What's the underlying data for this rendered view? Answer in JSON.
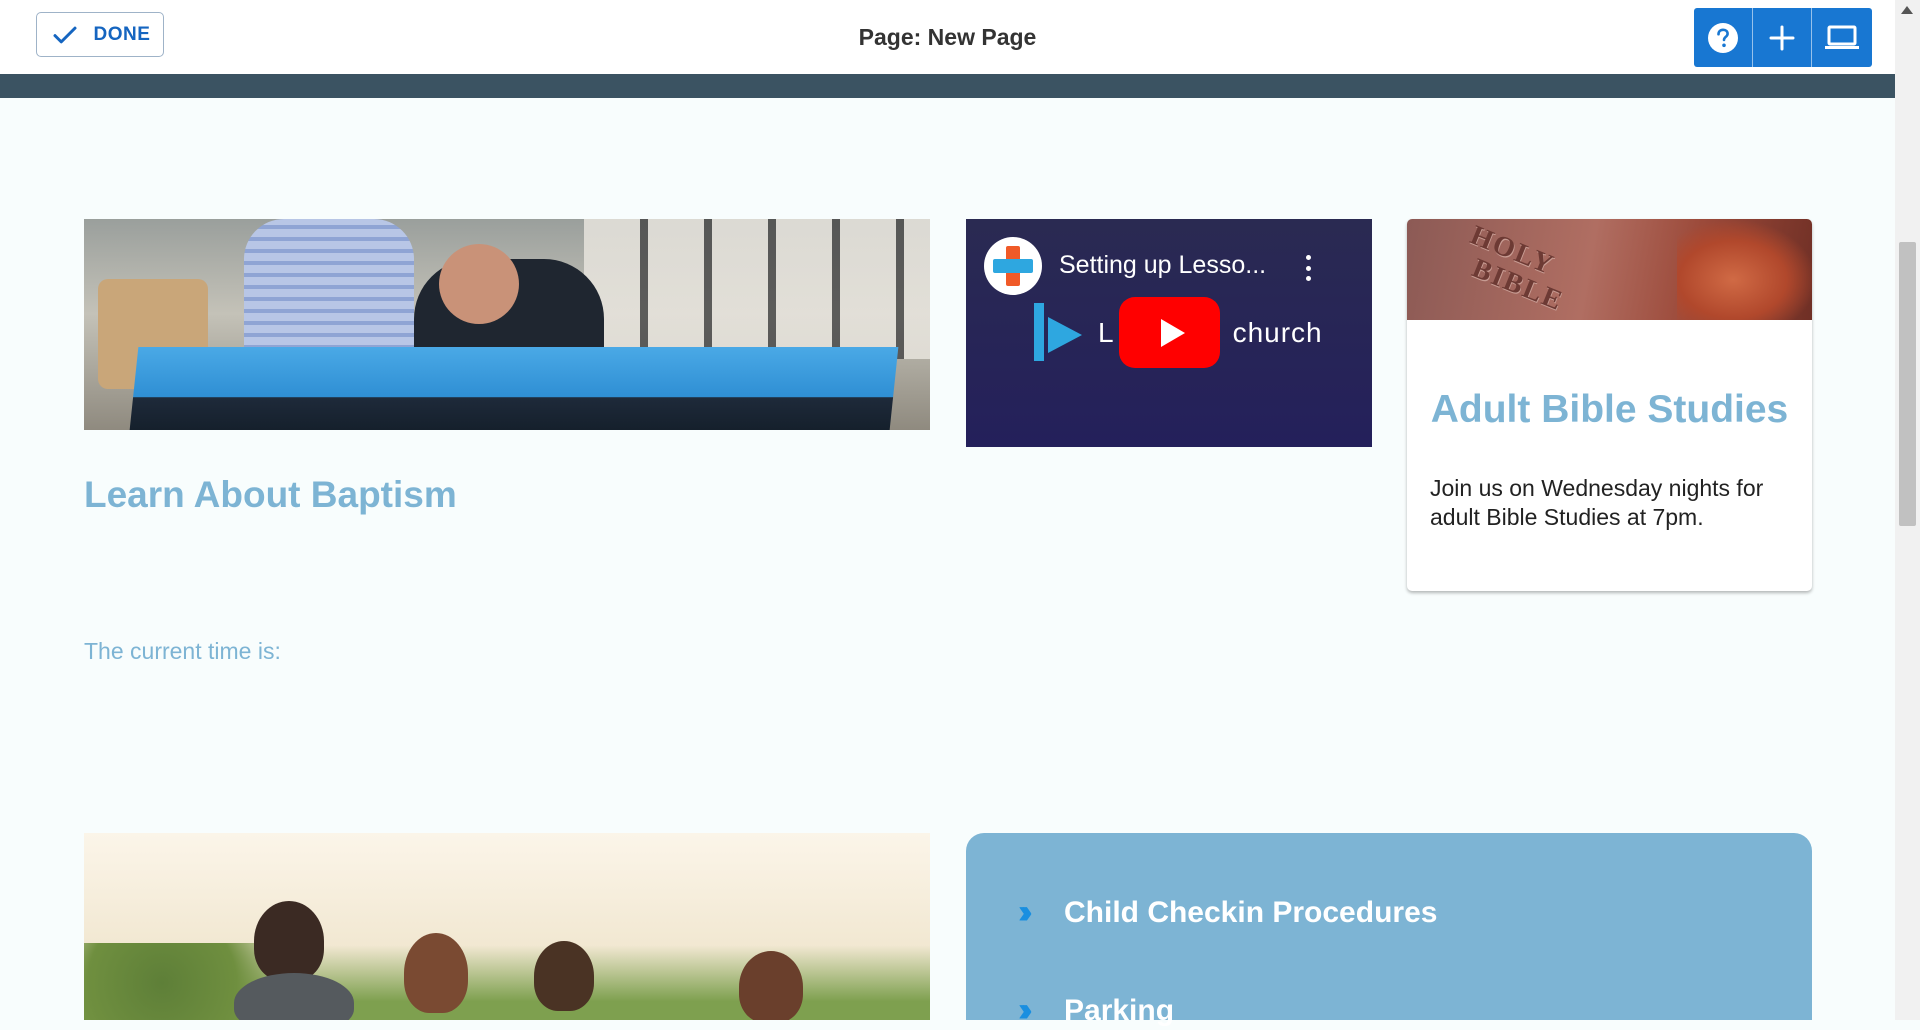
{
  "toolbar": {
    "done_label": "DONE",
    "page_title": "Page: New Page",
    "help_icon": "question-circle-icon",
    "add_icon": "plus-icon",
    "preview_icon": "laptop-icon"
  },
  "main": {
    "baptism_heading": "Learn About Baptism",
    "current_time_label": "The current time is:",
    "video": {
      "title": "Setting up Lesso...",
      "brand_text_left": "L",
      "brand_text_right": "church"
    },
    "bible_card": {
      "image_text_line1": "HOLY",
      "image_text_line2": "BIBLE",
      "title": "Adult Bible Studies",
      "text": "Join us on Wednesday nights for adult Bible Studies at 7pm."
    },
    "links": [
      {
        "label": "Child Checkin Procedures"
      },
      {
        "label": "Parking"
      }
    ]
  },
  "colors": {
    "accent_blue": "#1877d2",
    "heading_blue": "#7db4d4",
    "panel_blue": "#7db4d4",
    "dark_strip": "#3b5362",
    "youtube_red": "#ff0000"
  }
}
